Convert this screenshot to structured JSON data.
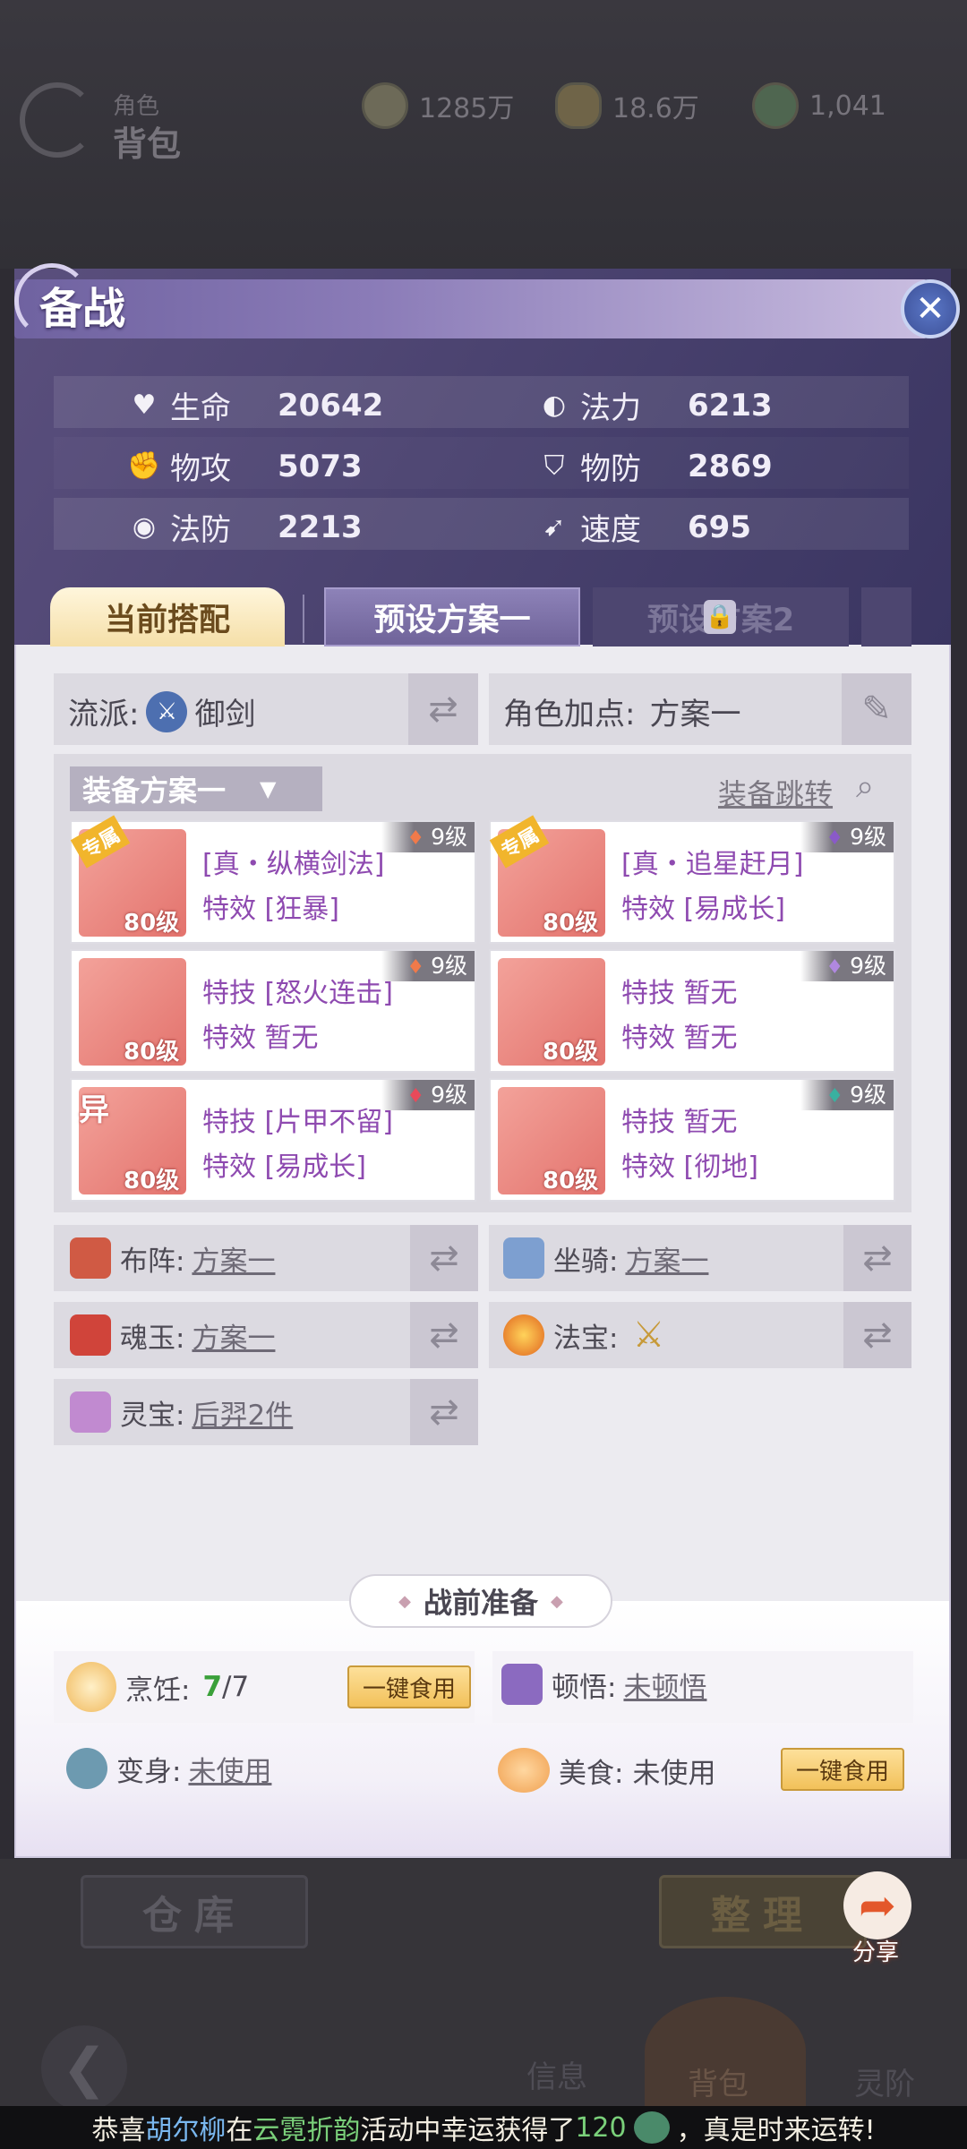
{
  "header": {
    "category": "角色",
    "title": "背包",
    "coins": "1285万",
    "ingots": "18.6万",
    "jade": "1,041"
  },
  "panel": {
    "title": "备战"
  },
  "stats": [
    {
      "icon": "heart-icon",
      "label": "生命",
      "value": "20642"
    },
    {
      "icon": "mana-icon",
      "label": "法力",
      "value": "6213"
    },
    {
      "icon": "attack-icon",
      "label": "物攻",
      "value": "5073"
    },
    {
      "icon": "defense-icon",
      "label": "物防",
      "value": "2869"
    },
    {
      "icon": "magic-defense-icon",
      "label": "法防",
      "value": "2213"
    },
    {
      "icon": "speed-icon",
      "label": "速度",
      "value": "695"
    }
  ],
  "tabs": [
    "当前搭配",
    "预设方案一",
    "预设方案2"
  ],
  "school": {
    "label": "流派:",
    "value": "御剑"
  },
  "points": {
    "label": "角色加点:",
    "value": "方案一"
  },
  "equip": {
    "dropdown": "装备方案一",
    "jump": "装备跳转",
    "items": [
      {
        "grade": "9级",
        "level": "80级",
        "tag": "专属",
        "line1": "[真・纵横剑法]",
        "line2": "特效 [狂暴]"
      },
      {
        "grade": "9级",
        "level": "80级",
        "tag": "专属",
        "line1": "[真・追星赶月]",
        "line2": "特效 [易成长]"
      },
      {
        "grade": "9级",
        "level": "80级",
        "tag": "",
        "line1": "特技 [怒火连击]",
        "line2": "特效 暂无"
      },
      {
        "grade": "9级",
        "level": "80级",
        "tag": "",
        "line1": "特技 暂无",
        "line2": "特效 暂无"
      },
      {
        "grade": "9级",
        "level": "80级",
        "tag": "异",
        "line1": "特技 [片甲不留]",
        "line2": "特效 [易成长]"
      },
      {
        "grade": "9级",
        "level": "80级",
        "tag": "",
        "line1": "特技 暂无",
        "line2": "特效 [彻地]"
      }
    ]
  },
  "options": [
    {
      "label": "布阵:",
      "value": "方案一"
    },
    {
      "label": "坐骑:",
      "value": "方案一"
    },
    {
      "label": "魂玉:",
      "value": "方案一"
    },
    {
      "label": "法宝:",
      "value": ""
    },
    {
      "label": "灵宝:",
      "value": "后羿2件"
    }
  ],
  "prep": {
    "title": "战前准备",
    "cook_label": "烹饪:",
    "cook_current": "7",
    "cook_total": "/7",
    "eat_btn": "一键食用",
    "insight_label": "顿悟:",
    "insight_value": "未顿悟",
    "transform_label": "变身:",
    "transform_value": "未使用",
    "food_label": "美食:",
    "food_value": "未使用"
  },
  "bottom": {
    "warehouse": "仓库",
    "sort": "整理",
    "share": "分享",
    "info": "信息",
    "bag": "背包",
    "rank": "灵阶"
  },
  "news": {
    "prefix": "恭喜",
    "name": "胡尔柳",
    "mid": "在",
    "event": "云霓折韵",
    "text": "活动中幸运获得了",
    "amount": "120",
    "suffix": "，真是时来运转!"
  },
  "colors": {
    "accent": "#8e4ab0",
    "panel_header": "#4b4370",
    "gold": "#f2c15a"
  }
}
